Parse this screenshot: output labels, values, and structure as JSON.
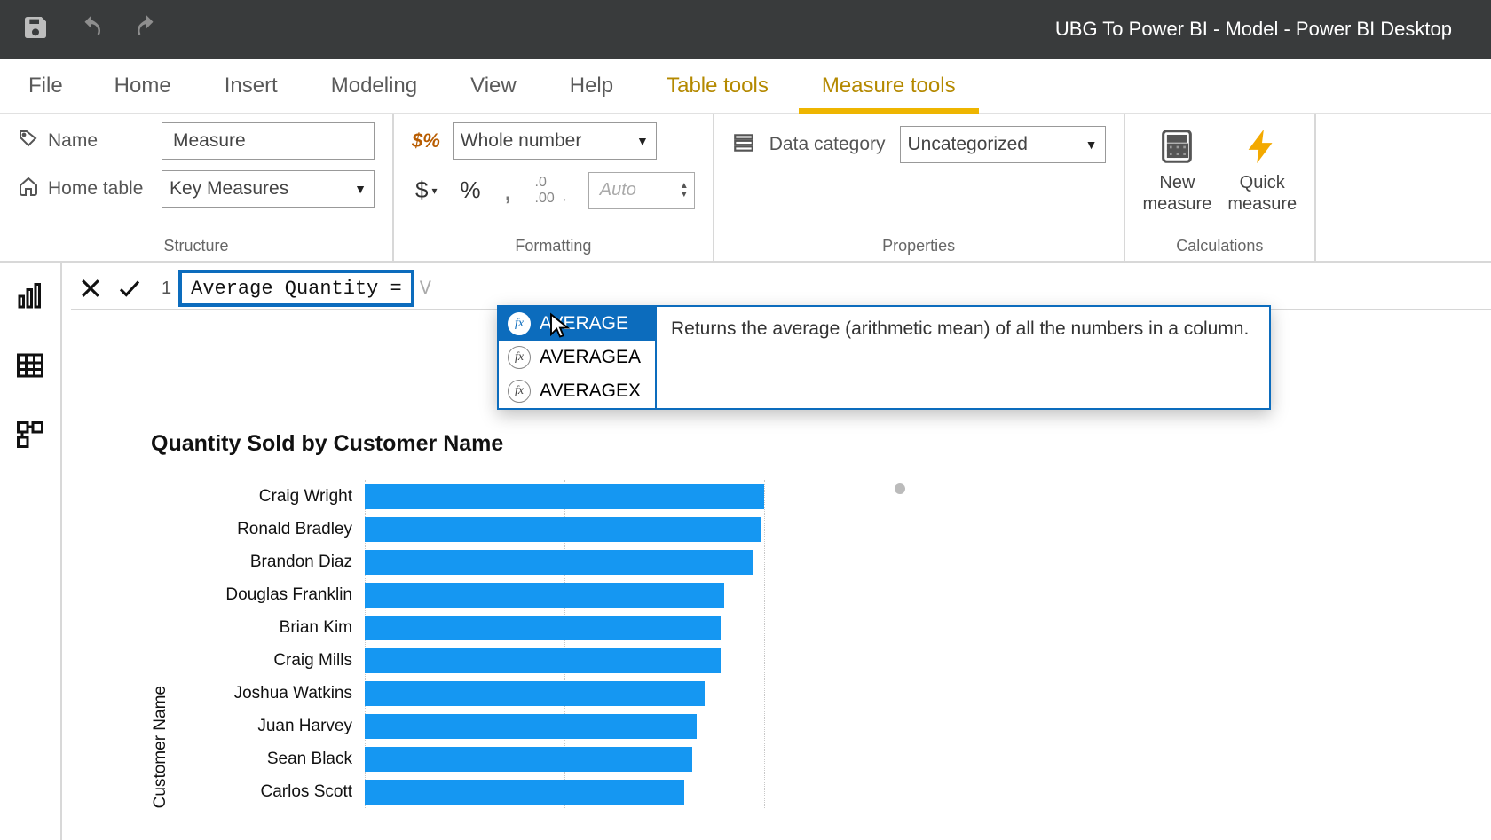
{
  "window": {
    "title": "UBG To Power BI - Model - Power BI Desktop"
  },
  "ribbon": {
    "tabs": {
      "file": "File",
      "home": "Home",
      "insert": "Insert",
      "modeling": "Modeling",
      "view": "View",
      "help": "Help",
      "table_tools": "Table tools",
      "measure_tools": "Measure tools"
    },
    "structure": {
      "group": "Structure",
      "name_label": "Name",
      "name_value": "Measure",
      "home_table_label": "Home table",
      "home_table_value": "Key Measures"
    },
    "formatting": {
      "group": "Formatting",
      "format_value": "Whole number",
      "currency": "$",
      "percent": "%",
      "thousands": ",",
      "decimals_btn": ".00",
      "decimal_placeholder": "Auto"
    },
    "properties": {
      "group": "Properties",
      "data_category_label": "Data category",
      "data_category_value": "Uncategorized"
    },
    "calculations": {
      "group": "Calculations",
      "new_measure": "New\nmeasure",
      "quick_measure": "Quick\nmeasure"
    }
  },
  "formula_bar": {
    "line": "1",
    "text": "Average Quantity = ",
    "typed": "V"
  },
  "intellisense": {
    "items": [
      {
        "name": "AVERAGE",
        "selected": true
      },
      {
        "name": "AVERAGEA",
        "selected": false
      },
      {
        "name": "AVERAGEX",
        "selected": false
      }
    ],
    "description": "Returns the average (arithmetic mean) of all the numbers in a column."
  },
  "chart_data": {
    "type": "bar",
    "title": "Quantity Sold by Customer Name",
    "ylabel": "Customer Name",
    "categories": [
      "Craig Wright",
      "Ronald Bradley",
      "Brandon Diaz",
      "Douglas Franklin",
      "Brian Kim",
      "Craig Mills",
      "Joshua Watkins",
      "Juan Harvey",
      "Sean Black",
      "Carlos Scott"
    ],
    "values": [
      100,
      99,
      97,
      90,
      89,
      89,
      85,
      83,
      82,
      80
    ],
    "xlim": [
      0,
      100
    ]
  },
  "colors": {
    "accent": "#1597f2",
    "highlight": "#0c6cbd",
    "ribbon_active": "#eeb500"
  }
}
